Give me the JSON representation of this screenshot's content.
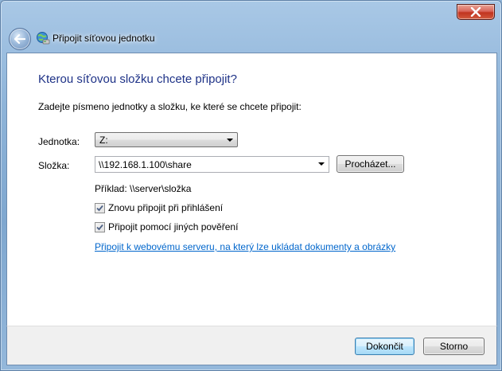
{
  "window": {
    "title": "Připojit síťovou jednotku",
    "close_glyph": "close-icon"
  },
  "page": {
    "heading": "Kterou síťovou složku chcete připojit?",
    "instruction": "Zadejte písmeno jednotky a složku, ke které se chcete připojit:"
  },
  "drive": {
    "label": "Jednotka:",
    "value": "Z:"
  },
  "folder": {
    "label": "Složka:",
    "value": "\\\\192.168.1.100\\share",
    "browse_label": "Procházet...",
    "example": "Příklad: \\\\server\\složka"
  },
  "options": {
    "reconnect_label": "Znovu připojit při přihlášení",
    "reconnect_checked": true,
    "other_credentials_label": "Připojit pomocí jiných pověření",
    "other_credentials_checked": true,
    "web_link": "Připojit k webovému serveru, na který lze ukládat dokumenty a obrázky"
  },
  "footer": {
    "finish_label": "Dokončit",
    "cancel_label": "Storno"
  },
  "colors": {
    "heading": "#1e3287",
    "link": "#0066cc"
  }
}
